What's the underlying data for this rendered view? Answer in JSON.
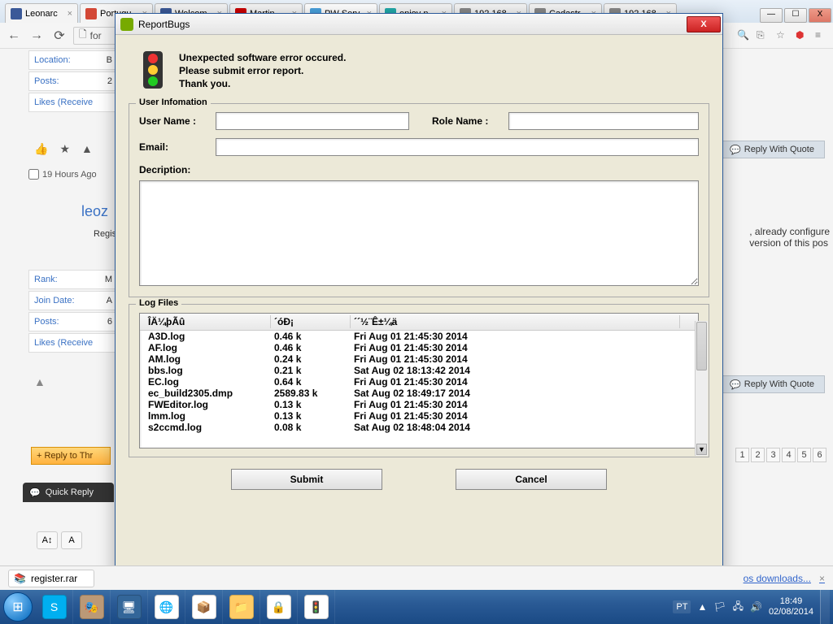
{
  "window": {
    "min": "—",
    "max": "☐",
    "close": "X"
  },
  "tabs": [
    {
      "label": "Leonarc",
      "fav": "#3b5998"
    },
    {
      "label": "Portugu",
      "fav": "#d34836"
    },
    {
      "label": "Welcom",
      "fav": "#3b5998"
    },
    {
      "label": "Martin",
      "fav": "#cc0000"
    },
    {
      "label": "PW Serv",
      "fav": "#4aa3df",
      "active": true
    },
    {
      "label": "enjoy n",
      "fav": "#2aa"
    },
    {
      "label": "192.168",
      "fav": "#888"
    },
    {
      "label": "Cadastr",
      "fav": "#888"
    },
    {
      "label": "192.168",
      "fav": "#888"
    }
  ],
  "toolbar": {
    "back": "←",
    "fwd": "→",
    "reload": "⟳",
    "url_prefix": "for",
    "star": "☆",
    "menu": "≡"
  },
  "page": {
    "side1": [
      {
        "k": "Location:",
        "v": "B"
      },
      {
        "k": "Posts:",
        "v": "2"
      },
      {
        "k": "Likes (Receive",
        "v": ""
      }
    ],
    "tool_icons": [
      "👍",
      "★",
      "▲"
    ],
    "hours": "19 Hours Ago",
    "leoz": "leoz",
    "regist": "Regist",
    "side2": [
      {
        "k": "Rank:",
        "v": "M"
      },
      {
        "k": "Join Date:",
        "v": "A"
      },
      {
        "k": "Posts:",
        "v": "6"
      },
      {
        "k": "Likes (Receive",
        "v": ""
      }
    ],
    "reply_quote": "Reply With Quote",
    "corner1": ", already configure",
    "corner2": " version of this pos",
    "reply_thr": "+ Reply to Thr",
    "pager": [
      "1",
      "2",
      "3",
      "4",
      "5",
      "6"
    ],
    "quick": "Quick Reply",
    "editor": [
      "A↕",
      "A"
    ]
  },
  "dialog": {
    "title": "ReportBugs",
    "intro": [
      "Unexpected software error occured.",
      "Please submit error report.",
      "Thank you."
    ],
    "groupUser": "User Infomation",
    "lblUser": "User Name :",
    "lblRole": "Role Name :",
    "lblEmail": "Email:",
    "lblDesc": "Decription:",
    "groupLog": "Log Files",
    "headers": [
      "ÎÄ¼þÃû",
      "´óÐ¡",
      "´´½¨Ê±¼ä"
    ],
    "rows": [
      {
        "f": "A3D.log",
        "s": "0.46 k",
        "d": "Fri Aug 01 21:45:30 2014"
      },
      {
        "f": "AF.log",
        "s": "0.46 k",
        "d": "Fri Aug 01 21:45:30 2014"
      },
      {
        "f": "AM.log",
        "s": "0.24 k",
        "d": "Fri Aug 01 21:45:30 2014"
      },
      {
        "f": "bbs.log",
        "s": "0.21 k",
        "d": "Sat Aug 02 18:13:42 2014"
      },
      {
        "f": "EC.log",
        "s": "0.64 k",
        "d": "Fri Aug 01 21:45:30 2014"
      },
      {
        "f": "ec_build2305.dmp",
        "s": "2589.83 k",
        "d": "Sat Aug 02 18:49:17 2014"
      },
      {
        "f": "FWEditor.log",
        "s": "0.13 k",
        "d": "Fri Aug 01 21:45:30 2014"
      },
      {
        "f": "lmm.log",
        "s": "0.13 k",
        "d": "Fri Aug 01 21:45:30 2014"
      },
      {
        "f": "s2ccmd.log",
        "s": "0.08 k",
        "d": "Sat Aug 02 18:48:04 2014"
      }
    ],
    "submit": "Submit",
    "cancel": "Cancel"
  },
  "download": {
    "file": "register.rar",
    "more_pre": "",
    "more": "os downloads...",
    "x": "×"
  },
  "systray": {
    "lang": "PT",
    "time": "18:49",
    "date": "02/08/2014"
  }
}
